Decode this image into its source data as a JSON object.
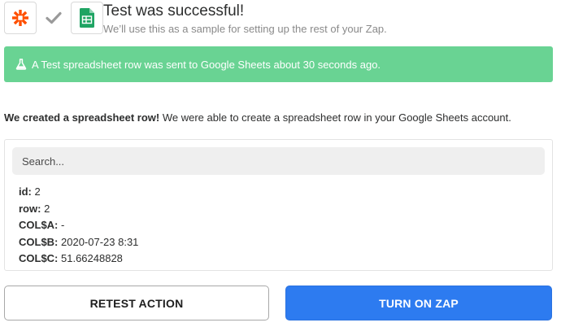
{
  "header": {
    "title": "Test was successful!",
    "subtitle": "We’ll use this as a sample for setting up the rest of your Zap.",
    "icons": [
      "zapier-logo-icon",
      "checkmark-icon",
      "google-sheets-icon"
    ]
  },
  "banner": {
    "icon": "flask-icon",
    "text": "A Test spreadsheet row was sent to Google Sheets about 30 seconds ago."
  },
  "description": {
    "bold": "We created a spreadsheet row!",
    "rest": " We were able to create a spreadsheet row in your Google Sheets account."
  },
  "search": {
    "placeholder": "Search..."
  },
  "fields": [
    {
      "key": "id:",
      "value": " 2"
    },
    {
      "key": "row:",
      "value": " 2"
    },
    {
      "key": "COL$A:",
      "value": " -"
    },
    {
      "key": "COL$B:",
      "value": " 2020-07-23 8:31"
    },
    {
      "key": "COL$C:",
      "value": " 51.66248828"
    }
  ],
  "buttons": {
    "retest": "RETEST ACTION",
    "turn_on": "TURN ON ZAP"
  },
  "colors": {
    "banner_bg": "#69d393",
    "primary_button": "#2d7bf0",
    "zapier_orange": "#ff4f00",
    "sheets_green": "#1fa463"
  }
}
